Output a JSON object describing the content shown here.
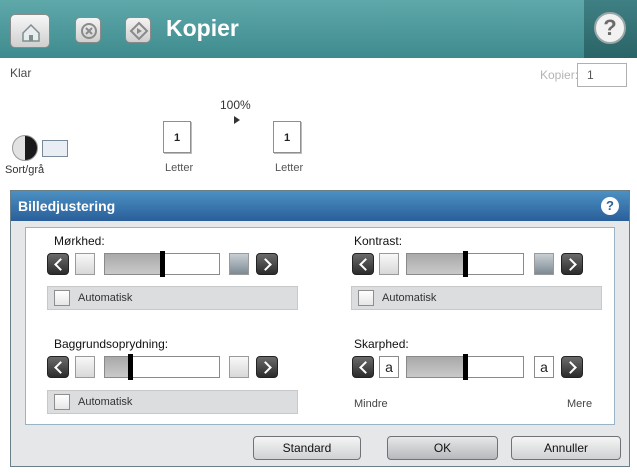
{
  "header": {
    "title": "Kopier"
  },
  "status": {
    "text": "Klar",
    "copies_label": "Kopier:",
    "copies_value": "1"
  },
  "preview": {
    "zoom": "100%",
    "original": {
      "count": "1",
      "label": "Letter"
    },
    "output": {
      "count": "1",
      "label": "Letter"
    },
    "color_mode_label": "Sort/grå"
  },
  "dialog": {
    "title": "Billedjustering",
    "darkness": {
      "label": "Mørkhed:",
      "auto_label": "Automatisk",
      "level": 0.5
    },
    "contrast": {
      "label": "Kontrast:",
      "auto_label": "Automatisk",
      "level": 0.5
    },
    "background": {
      "label": "Baggrundsoprydning:",
      "auto_label": "Automatisk",
      "level": 0.22
    },
    "sharpness": {
      "label": "Skarphed:",
      "glyph_left": "a",
      "glyph_right": "a",
      "min_label": "Mindre",
      "max_label": "Mere",
      "level": 0.5
    },
    "buttons": {
      "standard": "Standard",
      "ok": "OK",
      "cancel": "Annuller"
    }
  },
  "colors": {
    "topbar": "#4e9a9d",
    "dialog_header": "#2f6aa6"
  }
}
